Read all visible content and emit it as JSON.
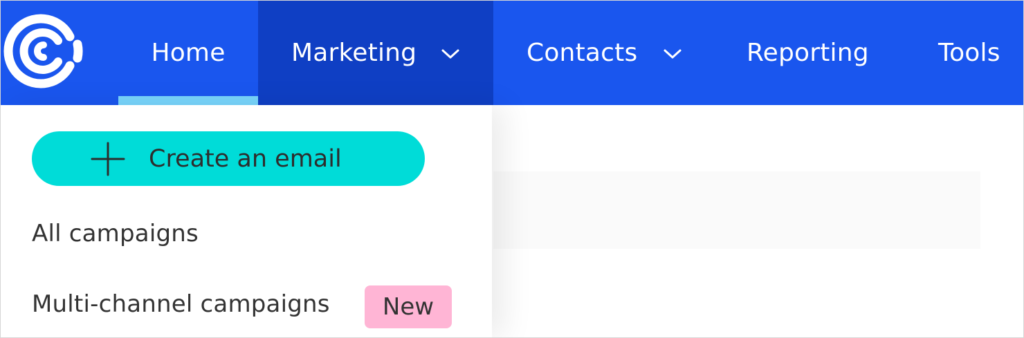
{
  "nav": {
    "items": [
      {
        "label": "Home"
      },
      {
        "label": "Marketing"
      },
      {
        "label": "Contacts"
      },
      {
        "label": "Reporting"
      },
      {
        "label": "Tools"
      }
    ],
    "active_item": "Home",
    "open_menu": "Marketing"
  },
  "dropdown": {
    "create_button": {
      "label": "Create an email",
      "icon": "plus-icon"
    },
    "items": [
      {
        "label": "All campaigns"
      },
      {
        "label": "Multi-channel campaigns",
        "badge": "New"
      }
    ]
  },
  "colors": {
    "nav_background": "#1a56ee",
    "nav_open_background": "#0f3fc4",
    "active_underline": "#78d4fb",
    "create_button": "#00dcd8",
    "badge_new": "#ffb5d5"
  }
}
